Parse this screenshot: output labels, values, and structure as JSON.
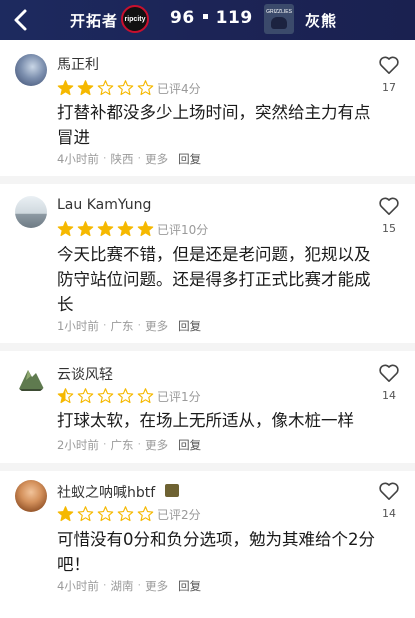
{
  "header": {
    "home_team": "开拓者",
    "home_logo_text": "ripcity",
    "home_score": "96",
    "away_score": "119",
    "away_logo_text": "GRIZZLIES",
    "away_team": "灰熊",
    "bg_color": "#1c2456"
  },
  "comments": [
    {
      "username": "馬正利",
      "stars": 2,
      "rated": "已评4分",
      "text": "打替补都没多少上场时间，突然给主力有点冒进",
      "time": "4小时前",
      "location": "陕西",
      "more": "更多",
      "reply": "回复",
      "likes": "17"
    },
    {
      "username": "Lau KamYung",
      "stars": 5,
      "rated": "已评10分",
      "text": "今天比赛不错，但是还是老问题，犯规以及防守站位问题。还是得多打正式比赛才能成长",
      "time": "1小时前",
      "location": "广东",
      "more": "更多",
      "reply": "回复",
      "likes": "15"
    },
    {
      "username": "云谈风轻",
      "stars": 0.5,
      "rated": "已评1分",
      "text": "打球太软，在场上无所适从，像木桩一样",
      "time": "2小时前",
      "location": "广东",
      "more": "更多",
      "reply": "回复",
      "likes": "14"
    },
    {
      "username": "社蚁之呐喊hbtf",
      "stars": 1,
      "rated": "已评2分",
      "text": "可惜没有0分和负分选项，勉为其难给个2分吧！",
      "time": "4小时前",
      "location": "湖南",
      "more": "更多",
      "reply": "回复",
      "likes": "14"
    }
  ],
  "colors": {
    "star_filled": "#f5b800",
    "star_empty": "#f5b800",
    "meta_gray": "#9a9a9a"
  },
  "icons": {
    "back": "chevron-left-icon",
    "like": "heart-outline-icon",
    "star": "star-icon"
  }
}
